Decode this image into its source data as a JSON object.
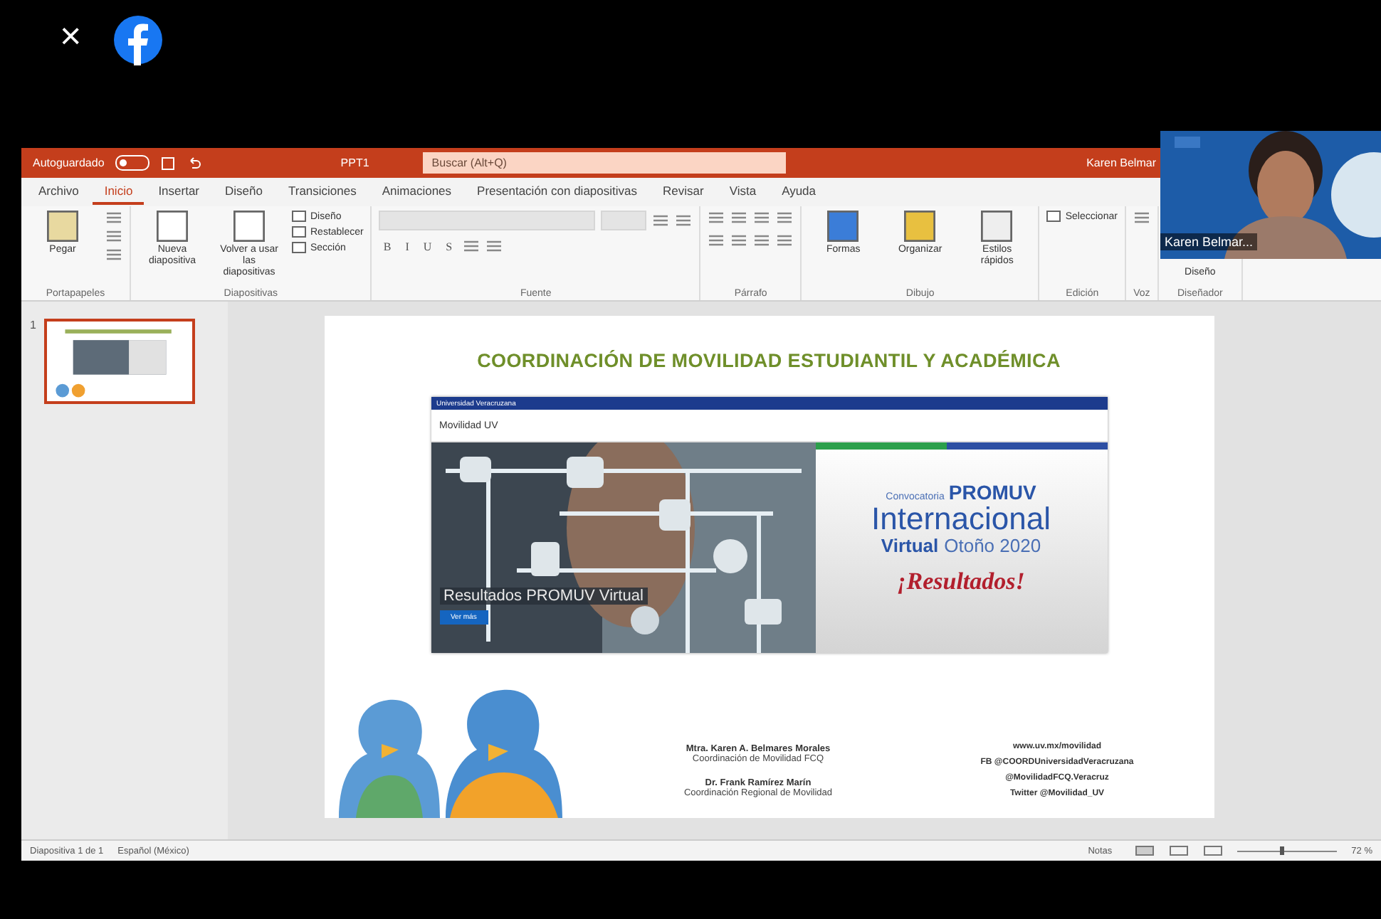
{
  "viewer": {
    "close": "×"
  },
  "ppt": {
    "title_bar": {
      "autosave": "Autoguardado",
      "autosave_on": false,
      "file_name": "PPT1",
      "search_placeholder": "Buscar (Alt+Q)",
      "user": "Karen Belmar"
    },
    "tabs": [
      {
        "label": "Archivo",
        "selected": false
      },
      {
        "label": "Inicio",
        "selected": true
      },
      {
        "label": "Insertar",
        "selected": false
      },
      {
        "label": "Diseño",
        "selected": false
      },
      {
        "label": "Transiciones",
        "selected": false
      },
      {
        "label": "Animaciones",
        "selected": false
      },
      {
        "label": "Presentación con diapositivas",
        "selected": false
      },
      {
        "label": "Revisar",
        "selected": false
      },
      {
        "label": "Vista",
        "selected": false
      },
      {
        "label": "Ayuda",
        "selected": false
      }
    ],
    "ribbon_groups": [
      {
        "label": "Portapapeles",
        "kind": "clipboard",
        "buttons": [
          "Pegar"
        ]
      },
      {
        "label": "Diapositivas",
        "kind": "slides",
        "buttons": [
          "Nueva diapositiva",
          "Volver a usar las diapositivas"
        ],
        "small_buttons": [
          "Diseño",
          "Restablecer",
          "Sección"
        ]
      },
      {
        "label": "Fuente",
        "kind": "font",
        "format_buttons": [
          "B",
          "I",
          "U",
          "S"
        ]
      },
      {
        "label": "Párrafo",
        "kind": "paragraph"
      },
      {
        "label": "Dibujo",
        "kind": "drawing",
        "buttons": [
          "Formas",
          "Organizar",
          "Estilos rápidos"
        ]
      },
      {
        "label": "Edición",
        "kind": "editing",
        "small_buttons": [
          "Seleccionar"
        ]
      },
      {
        "label": "Voz",
        "kind": "voice"
      },
      {
        "label": "Diseñador",
        "kind": "designer",
        "buttons": [
          "Diseño"
        ]
      }
    ],
    "thumbnails": [
      {
        "number": "1",
        "selected": true
      }
    ],
    "slide": {
      "title": "COORDINACIÓN DE MOVILIDAD ESTUDIANTIL Y ACADÉMICA",
      "web": {
        "header": "Universidad Veracruzana",
        "site_title": "Movilidad UV",
        "photo_caption": "Resultados PROMUV Virtual",
        "photo_button": "Ver más",
        "promo": {
          "lead": "Convocatoria",
          "brand": "PROMUV",
          "headline": "Internacional",
          "virtual": "Virtual",
          "term": "Otoño 2020",
          "result": "¡Resultados!"
        }
      },
      "contacts": [
        {
          "name": "Mtra. Karen A. Belmares Morales",
          "role": "Coordinación de Movilidad FCQ"
        },
        {
          "name": "Dr. Frank Ramírez Marín",
          "role": "Coordinación Regional de Movilidad"
        }
      ],
      "links": [
        "www.uv.mx/movilidad",
        "FB @COORDUniversidadVeracruzana",
        "@MovilidadFCQ.Veracruz",
        "Twitter @Movilidad_UV"
      ]
    },
    "status_bar": {
      "slide_count": "Diapositiva 1 de 1",
      "language": "Español (México)",
      "notes": "Notas",
      "zoom": "72 %",
      "zoom_slider": {
        "level": 0.45
      }
    }
  },
  "video_tile": {
    "name": "Karen Belmar..."
  }
}
